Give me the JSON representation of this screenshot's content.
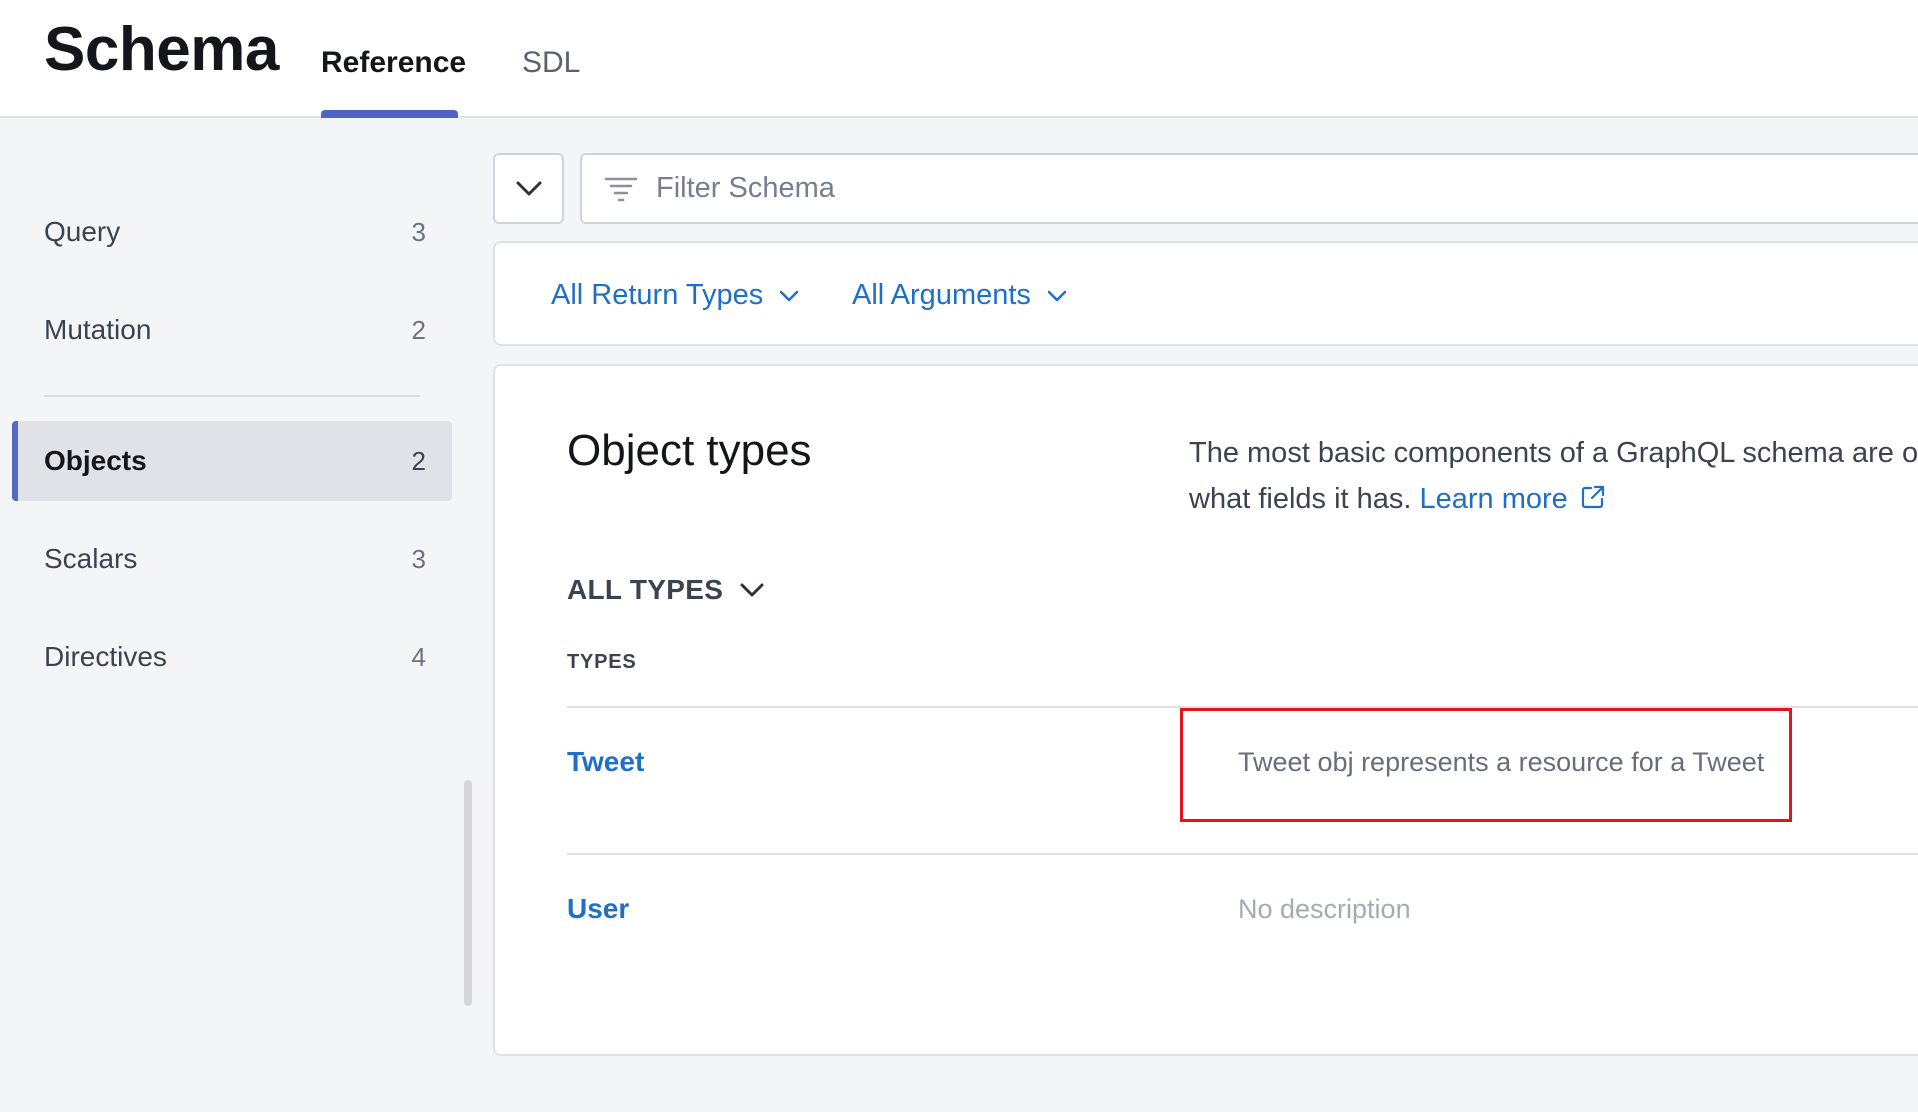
{
  "header": {
    "title": "Schema",
    "tabs": [
      {
        "label": "Reference",
        "active": true
      },
      {
        "label": "SDL",
        "active": false
      }
    ]
  },
  "sidebar": {
    "items": [
      {
        "label": "Query",
        "count": "3"
      },
      {
        "label": "Mutation",
        "count": "2"
      },
      {
        "label": "Objects",
        "count": "2",
        "active": true
      },
      {
        "label": "Scalars",
        "count": "3"
      },
      {
        "label": "Directives",
        "count": "4"
      }
    ]
  },
  "filter": {
    "collapse_icon": "chevron-down-icon",
    "filter_icon": "filter-lines-icon",
    "placeholder": "Filter Schema",
    "value": "",
    "dropdowns": [
      {
        "label": "All Return Types",
        "icon": "chevron-down-icon"
      },
      {
        "label": "All Arguments",
        "icon": "chevron-down-icon"
      }
    ]
  },
  "main": {
    "title": "Object types",
    "description_text": "The most basic components of a GraphQL schema are obje",
    "description_text_2": "what fields it has.",
    "learn_more_label": "Learn more",
    "learn_more_icon": "external-link-icon",
    "all_types_label": "ALL TYPES",
    "types_header": "TYPES",
    "types": [
      {
        "name": "Tweet",
        "description": "Tweet obj represents a resource for a Tweet",
        "highlighted": true
      },
      {
        "name": "User",
        "description": "No description",
        "highlighted": false
      }
    ]
  },
  "colors": {
    "accent": "#4f63c7",
    "link": "#1f6fc6",
    "highlight_border": "#e3141b",
    "background": "#f4f5f7"
  }
}
